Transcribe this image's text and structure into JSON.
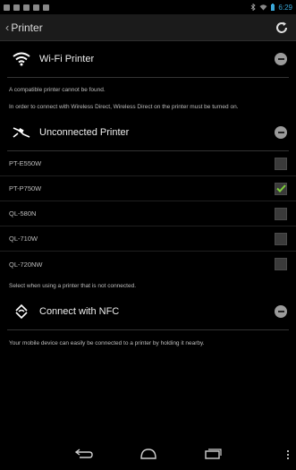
{
  "status_bar": {
    "time": "6:29"
  },
  "action_bar": {
    "title": "Printer"
  },
  "wifi_section": {
    "title": "Wi-Fi Printer",
    "info_1": "A compatible printer cannot be found.",
    "info_2": "In order to connect with Wireless Direct, Wireless Direct on the printer must be turned on."
  },
  "unconnected_section": {
    "title": "Unconnected Printer",
    "printers": [
      {
        "name": "PT-E550W",
        "checked": false
      },
      {
        "name": "PT-P750W",
        "checked": true
      },
      {
        "name": "QL-580N",
        "checked": false
      },
      {
        "name": "QL-710W",
        "checked": false
      },
      {
        "name": "QL-720NW",
        "checked": false
      }
    ],
    "note": "Select when using a printer that is not connected."
  },
  "nfc_section": {
    "title": "Connect with NFC",
    "info": "Your mobile device can easily be connected to a printer by holding it nearby."
  },
  "colors": {
    "check": "#7fd13b",
    "time": "#3aa7d8"
  }
}
